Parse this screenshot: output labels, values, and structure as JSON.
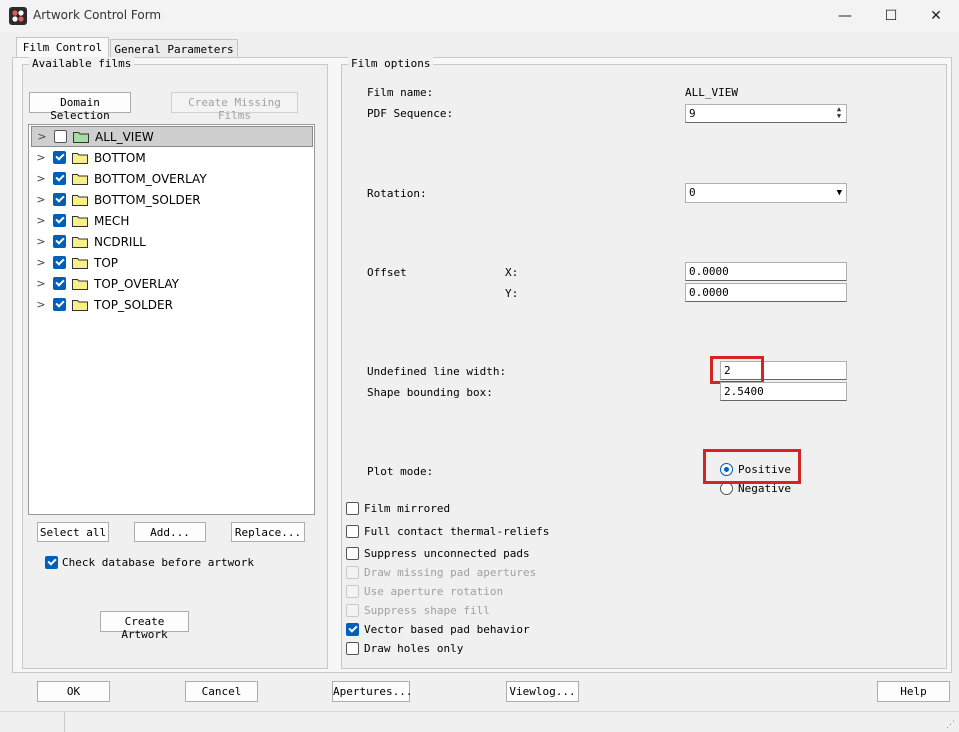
{
  "window": {
    "title": "Artwork Control Form",
    "minimize": "—",
    "maximize": "☐",
    "close": "✕"
  },
  "tabs": [
    "Film Control",
    "General Parameters"
  ],
  "left": {
    "group_label": "Available films",
    "domain_button": "Domain Selection",
    "create_missing_button": "Create Missing Films",
    "films": [
      {
        "name": "ALL_VIEW",
        "checked": false,
        "selected": true,
        "folder_color": "#a4dea4"
      },
      {
        "name": "BOTTOM",
        "checked": true,
        "selected": false,
        "folder_color": "#f7f08a"
      },
      {
        "name": "BOTTOM_OVERLAY",
        "checked": true,
        "selected": false,
        "folder_color": "#f7f08a"
      },
      {
        "name": "BOTTOM_SOLDER",
        "checked": true,
        "selected": false,
        "folder_color": "#f7f08a"
      },
      {
        "name": "MECH",
        "checked": true,
        "selected": false,
        "folder_color": "#f7f08a"
      },
      {
        "name": "NCDRILL",
        "checked": true,
        "selected": false,
        "folder_color": "#f7f08a"
      },
      {
        "name": "TOP",
        "checked": true,
        "selected": false,
        "folder_color": "#f7f08a"
      },
      {
        "name": "TOP_OVERLAY",
        "checked": true,
        "selected": false,
        "folder_color": "#f7f08a"
      },
      {
        "name": "TOP_SOLDER",
        "checked": true,
        "selected": false,
        "folder_color": "#f7f08a"
      }
    ],
    "select_all": "Select all",
    "add": "Add...",
    "replace": "Replace...",
    "check_db_label": "Check database before artwork",
    "check_db_checked": true,
    "create_artwork": "Create Artwork"
  },
  "right": {
    "group_label": "Film options",
    "film_name_label": "Film name:",
    "film_name_value": "ALL_VIEW",
    "pdf_seq_label": "PDF Sequence:",
    "pdf_seq_value": "9",
    "rotation_label": "Rotation:",
    "rotation_value": "0",
    "offset_label": "Offset",
    "x_label": "X:",
    "x_value": "0.0000",
    "y_label": "Y:",
    "y_value": "0.0000",
    "undef_width_label": "Undefined line width:",
    "undef_width_value": "2",
    "shape_bbox_label": "Shape bounding box:",
    "shape_bbox_value": "2.5400",
    "plot_mode_label": "Plot mode:",
    "positive": "Positive",
    "negative": "Negative",
    "options": [
      {
        "label": "Film mirrored",
        "checked": false,
        "disabled": false
      },
      {
        "label": "Full contact thermal-reliefs",
        "checked": false,
        "disabled": false
      },
      {
        "label": "Suppress unconnected pads",
        "checked": false,
        "disabled": false
      },
      {
        "label": "Draw missing pad apertures",
        "checked": false,
        "disabled": true
      },
      {
        "label": "Use aperture rotation",
        "checked": false,
        "disabled": true
      },
      {
        "label": "Suppress shape fill",
        "checked": false,
        "disabled": true
      },
      {
        "label": "Vector based pad behavior",
        "checked": true,
        "disabled": false
      },
      {
        "label": "Draw holes only",
        "checked": false,
        "disabled": false
      }
    ]
  },
  "footer": {
    "ok": "OK",
    "cancel": "Cancel",
    "apertures": "Apertures...",
    "viewlog": "Viewlog...",
    "help": "Help"
  },
  "colors": {
    "highlight": "#d42424",
    "accent": "#005fb8"
  }
}
